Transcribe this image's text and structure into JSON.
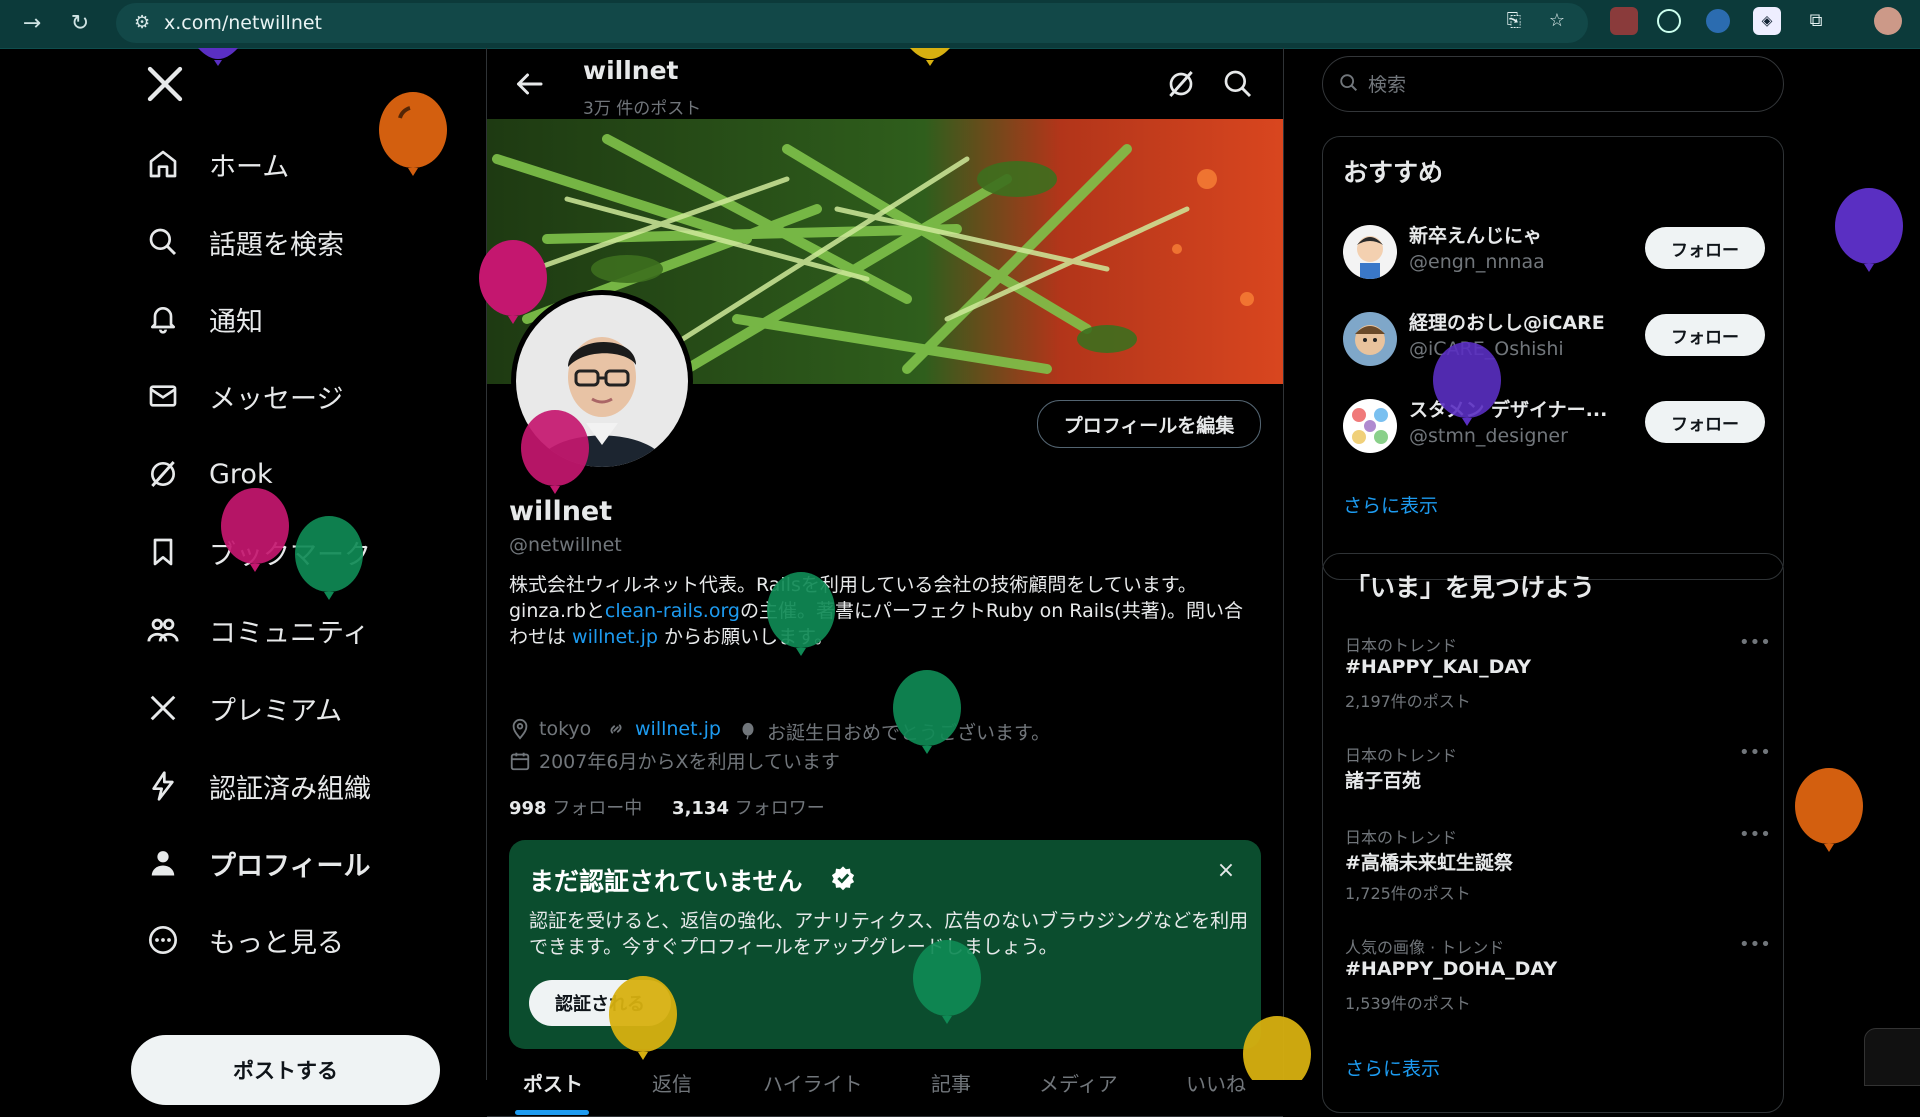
{
  "browser": {
    "url": "x.com/netwillnet"
  },
  "nav": {
    "items": [
      {
        "label": "ホーム",
        "icon": "home-icon"
      },
      {
        "label": "話題を検索",
        "icon": "search-icon"
      },
      {
        "label": "通知",
        "icon": "bell-icon"
      },
      {
        "label": "メッセージ",
        "icon": "mail-icon"
      },
      {
        "label": "Grok",
        "icon": "grok-icon"
      },
      {
        "label": "ブックマーク",
        "icon": "bookmark-icon"
      },
      {
        "label": "コミュニティ",
        "icon": "people-icon"
      },
      {
        "label": "プレミアム",
        "icon": "x-icon"
      },
      {
        "label": "認証済み組織",
        "icon": "lightning-icon"
      },
      {
        "label": "プロフィール",
        "icon": "person-icon"
      },
      {
        "label": "もっと見る",
        "icon": "more-circle-icon"
      }
    ],
    "post_button": "ポストする"
  },
  "profile": {
    "name": "willnet",
    "post_count": "3万 件のポスト",
    "handle": "@netwillnet",
    "edit_button": "プロフィールを編集",
    "bio": {
      "part1": "株式会社ウィルネット代表。Railsを利用している会社の技術顧問をしています。ginza.rbと",
      "link1": "clean-rails.org",
      "part2": "の主催。著書にパーフェクトRuby on Rails(共著)。問い合わせは ",
      "link2": "willnet.jp",
      "part3": " からお願いします。"
    },
    "location": "tokyo",
    "website": "willnet.jp",
    "birthday": "お誕生日おめでとうございます。",
    "joined": "2007年6月からXを利用しています",
    "following_count": "998",
    "following_label": "フォロー中",
    "followers_count": "3,134",
    "followers_label": "フォロワー"
  },
  "verify_card": {
    "title": "まだ認証されていません",
    "description": "認証を受けると、返信の強化、アナリティクス、広告のないブラウジングなどを利用できます。今すぐプロフィールをアップグレードしましょう。",
    "button": "認証される",
    "close": "×"
  },
  "tabs": [
    "ポスト",
    "返信",
    "ハイライト",
    "記事",
    "メディア",
    "いいね"
  ],
  "search": {
    "placeholder": "検索"
  },
  "recommend": {
    "title": "おすすめ",
    "users": [
      {
        "name": "新卒えんじにゃ",
        "handle": "@engn_nnnaa",
        "button": "フォロー"
      },
      {
        "name": "経理のおしし@iCARE",
        "handle": "@iCARE_Oshishi",
        "button": "フォロー"
      },
      {
        "name": "スタメン デザイナー...",
        "handle": "@stmn_designer",
        "button": "フォロー"
      }
    ],
    "show_more": "さらに表示"
  },
  "trends": {
    "title": "「いま」を見つけよう",
    "items": [
      {
        "context": "日本のトレンド",
        "name": "#HAPPY_KAI_DAY",
        "count": "2,197件のポスト"
      },
      {
        "context": "日本のトレンド",
        "name": "諸子百苑",
        "count": ""
      },
      {
        "context": "日本のトレンド",
        "name": "#高橋未来虹生誕祭",
        "count": "1,725件のポスト"
      },
      {
        "context": "人気の画像 · トレンド",
        "name": "#HAPPY_DOHA_DAY",
        "count": "1,539件のポスト"
      }
    ],
    "show_more": "さらに表示"
  },
  "colors": {
    "accent": "#1d9bf0",
    "verify_bg": "#0b4d2e",
    "chrome_bg": "#0c3a3a"
  }
}
